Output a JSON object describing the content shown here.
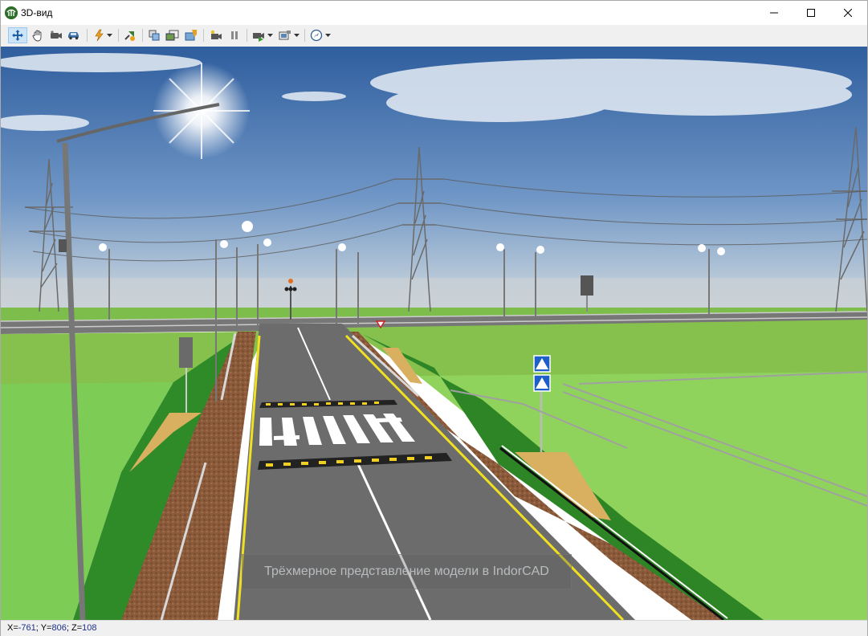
{
  "window": {
    "title": "3D-вид"
  },
  "toolbar": {
    "buttons": [
      {
        "icon": "move-arrows-icon",
        "active": true
      },
      {
        "icon": "hand-pan-icon"
      },
      {
        "icon": "camera-icon"
      },
      {
        "icon": "car-icon"
      },
      {
        "icon": "lightning-icon",
        "dropdown": true
      },
      {
        "icon": "fly-path-icon"
      },
      {
        "icon": "copy-view-icon"
      },
      {
        "icon": "export-image-icon"
      },
      {
        "icon": "save-image-icon"
      },
      {
        "icon": "record-camera-icon"
      },
      {
        "icon": "pause-icon"
      },
      {
        "icon": "play-camera-icon",
        "dropdown": true
      },
      {
        "icon": "render-settings-icon",
        "dropdown": true
      },
      {
        "icon": "compass-icon",
        "dropdown": true
      }
    ]
  },
  "viewport": {
    "caption": "Трёхмерное представление модели в IndorCAD",
    "scene": "3D road model with pedestrian crossing, street lamps and power line towers"
  },
  "status": {
    "x_label": "X=",
    "x": "-761",
    "y_label": "Y=",
    "y": "806",
    "z_label": "Z=",
    "z": "108",
    "sep": "; "
  },
  "colors": {
    "sky_top": "#3d6aa8",
    "grass": "#7cc24e",
    "road": "#6b6b6b",
    "accent": "#cce4f7"
  }
}
